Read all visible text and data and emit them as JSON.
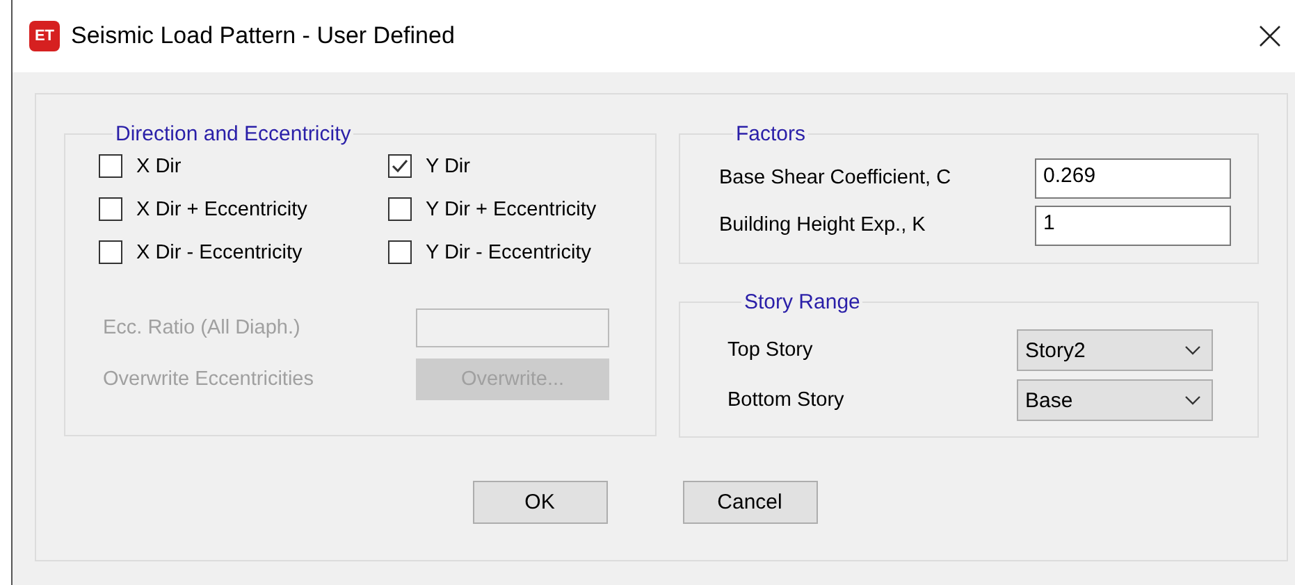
{
  "window": {
    "title": "Seismic Load Pattern - User Defined",
    "app_badge": "ET"
  },
  "direction_group": {
    "title": "Direction and Eccentricity",
    "checkboxes": [
      {
        "label": "X Dir",
        "checked": false
      },
      {
        "label": "Y Dir",
        "checked": true
      },
      {
        "label": "X Dir + Eccentricity",
        "checked": false
      },
      {
        "label": "Y Dir + Eccentricity",
        "checked": false
      },
      {
        "label": "X Dir - Eccentricity",
        "checked": false
      },
      {
        "label": "Y Dir - Eccentricity",
        "checked": false
      }
    ],
    "ecc_ratio": {
      "label": "Ecc. Ratio (All Diaph.)",
      "disabled": true
    },
    "overwrite": {
      "label": "Overwrite Eccentricities",
      "button": "Overwrite...",
      "disabled": true
    }
  },
  "factors": {
    "title": "Factors",
    "fields": [
      {
        "label": "Base Shear Coefficient, C",
        "value": "0.269"
      },
      {
        "label": "Building Height Exp., K",
        "value": "1"
      }
    ]
  },
  "story_range": {
    "title": "Story Range",
    "dropdowns": [
      {
        "label": "Top Story",
        "value": "Story2"
      },
      {
        "label": "Bottom Story",
        "value": "Base"
      }
    ]
  },
  "buttons": [
    "OK",
    "Cancel"
  ]
}
